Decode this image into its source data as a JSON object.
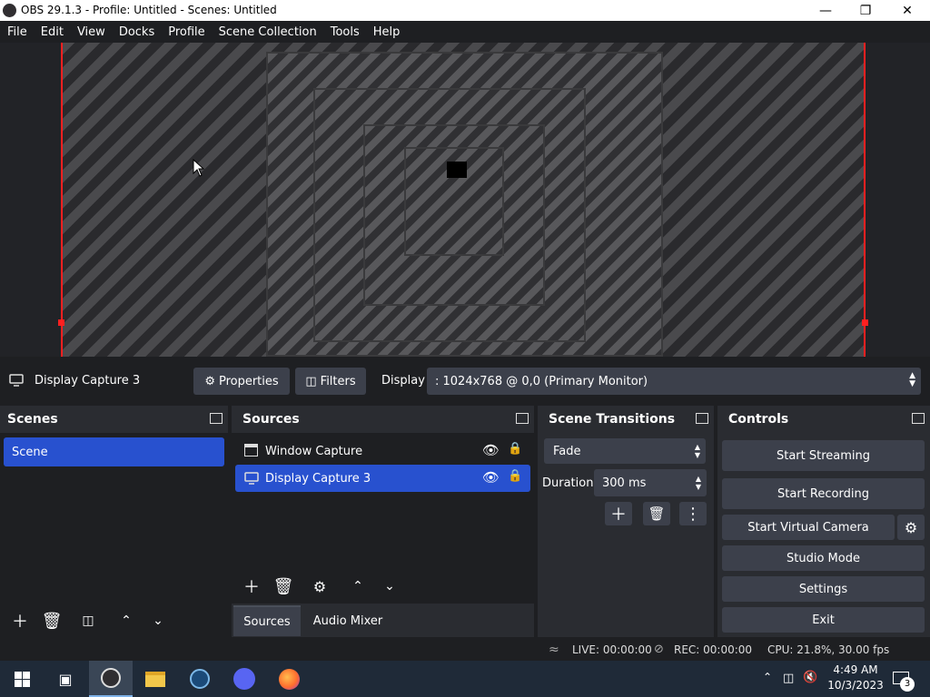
{
  "window": {
    "title": "OBS 29.1.3 - Profile: Untitled - Scenes: Untitled"
  },
  "menu": [
    "File",
    "Edit",
    "View",
    "Docks",
    "Profile",
    "Scene Collection",
    "Tools",
    "Help"
  ],
  "source_bar": {
    "source_name": "Display Capture 3",
    "properties_label": "Properties",
    "filters_label": "Filters",
    "display_label": "Display",
    "display_value": ": 1024x768 @ 0,0 (Primary Monitor)"
  },
  "scenes": {
    "title": "Scenes",
    "items": [
      "Scene"
    ]
  },
  "sources": {
    "title": "Sources",
    "items": [
      {
        "name": "Window Capture",
        "selected": false
      },
      {
        "name": "Display Capture 3",
        "selected": true
      }
    ],
    "tabs": [
      "Sources",
      "Audio Mixer"
    ]
  },
  "transitions": {
    "title": "Scene Transitions",
    "type": "Fade",
    "duration_label": "Duration",
    "duration_value": "300 ms"
  },
  "controls": {
    "title": "Controls",
    "start_streaming": "Start Streaming",
    "start_recording": "Start Recording",
    "start_virtual_camera": "Start Virtual Camera",
    "studio_mode": "Studio Mode",
    "settings": "Settings",
    "exit": "Exit"
  },
  "status": {
    "live": "LIVE: 00:00:00",
    "rec": "REC: 00:00:00",
    "cpu": "CPU: 21.8%, 30.00 fps"
  },
  "taskbar": {
    "time": "4:49 AM",
    "date": "10/3/2023",
    "notifications": "3"
  },
  "colors": {
    "accent": "#2851cf",
    "bg": "#1e1f22",
    "dock": "#2a2c31",
    "button": "#3c404b",
    "bounds": "#ff2020"
  }
}
